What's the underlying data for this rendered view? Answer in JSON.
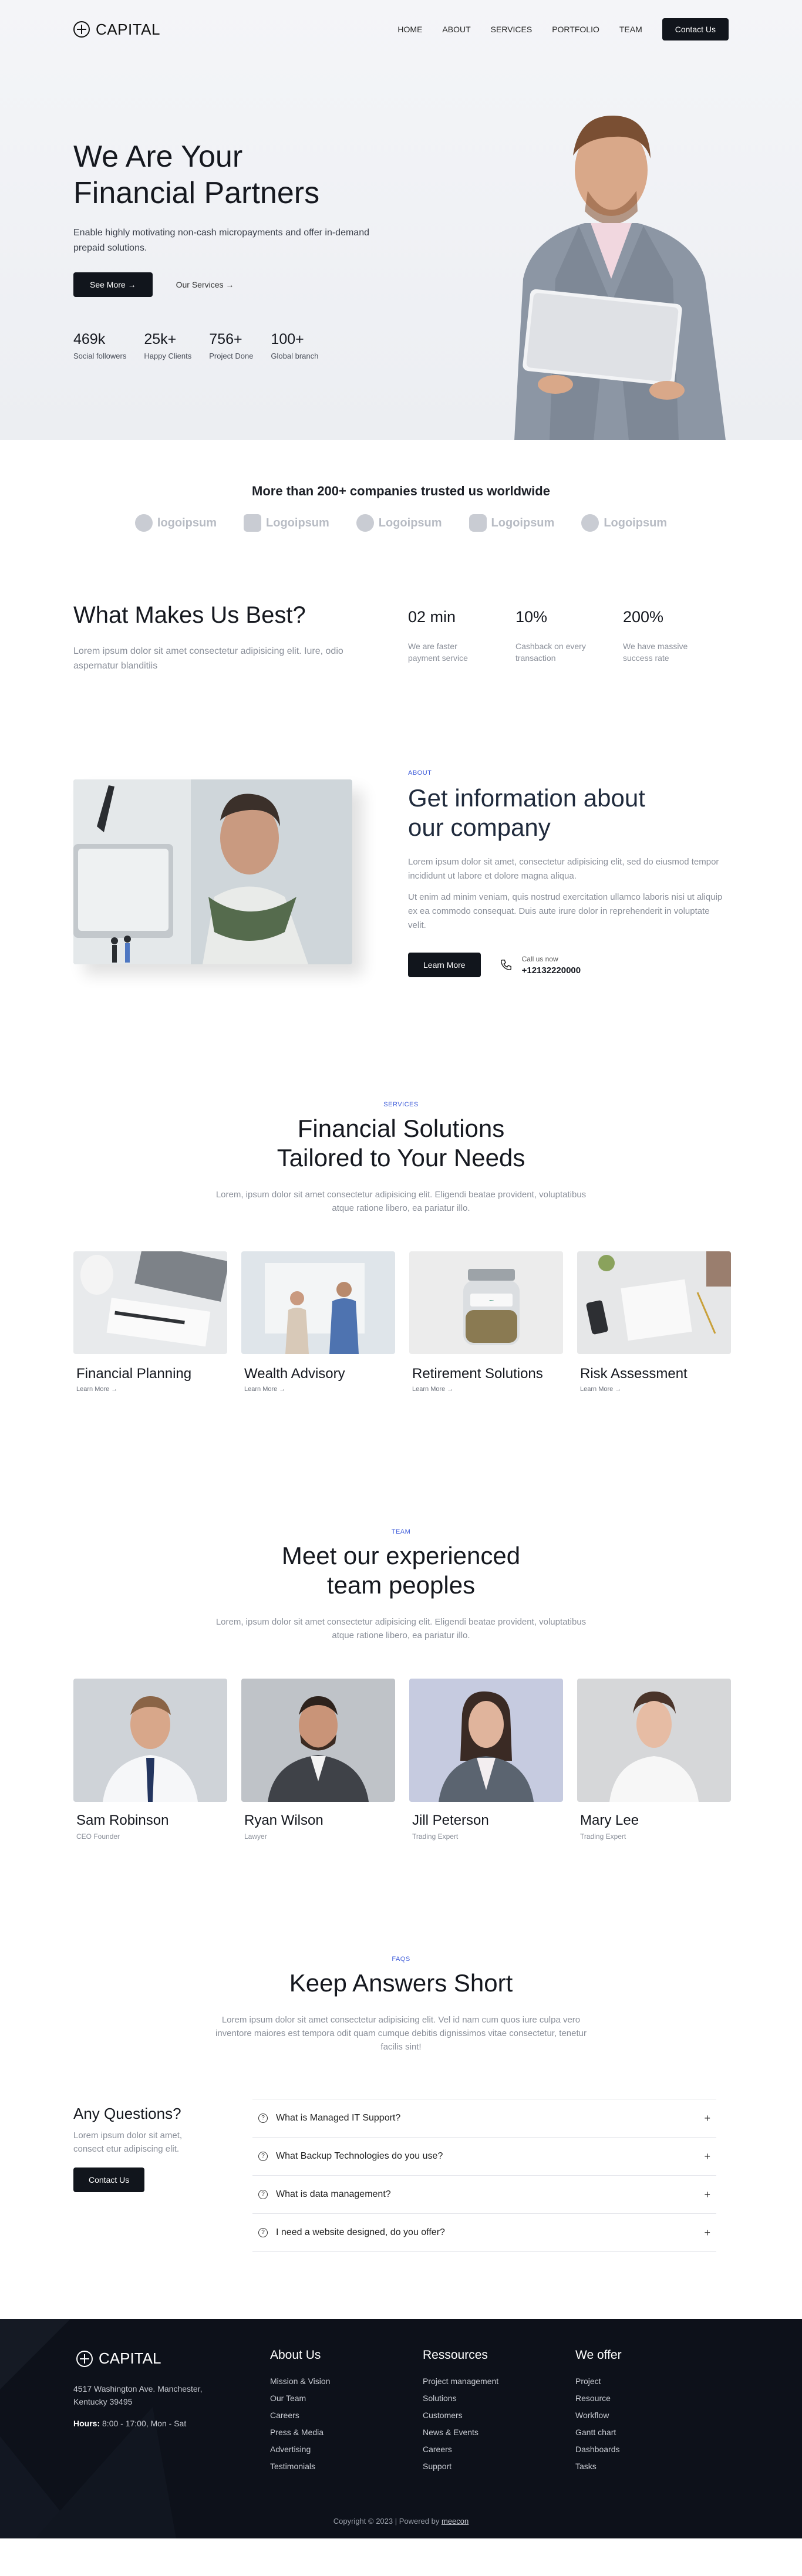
{
  "brand": "CAPITAL",
  "nav": {
    "links": [
      "HOME",
      "ABOUT",
      "SERVICES",
      "PORTFOLIO",
      "TEAM"
    ],
    "cta": "Contact Us"
  },
  "hero": {
    "title_line1": "We Are Your",
    "title_line2": "Financial Partners",
    "subtitle": "Enable highly motivating non-cash micropayments and offer in-demand prepaid solutions.",
    "primary_button": "See More →",
    "secondary_link": "Our Services →",
    "stats": [
      {
        "value": "469k",
        "label": "Social followers"
      },
      {
        "value": "25k+",
        "label": "Happy Clients"
      },
      {
        "value": "756+",
        "label": "Project Done"
      },
      {
        "value": "100+",
        "label": "Global branch"
      }
    ]
  },
  "trusted": {
    "title": "More than 200+ companies trusted us worldwide",
    "logos": [
      "logoipsum",
      "Logoipsum",
      "Logoipsum",
      "Logoipsum",
      "Logoipsum"
    ]
  },
  "why": {
    "title": "What Makes Us Best?",
    "text": "Lorem ipsum dolor sit amet consectetur adipisicing elit. Iure, odio aspernatur blanditiis",
    "stats": [
      {
        "value": "02 min",
        "label": "We are faster payment service"
      },
      {
        "value": "10%",
        "label": "Cashback on every transaction"
      },
      {
        "value": "200%",
        "label": "We have massive success rate"
      }
    ]
  },
  "about": {
    "eyebrow": "ABOUT",
    "title_line1": "Get information about",
    "title_line2": "our company",
    "para1": "Lorem ipsum dolor sit amet, consectetur adipisicing elit, sed do eiusmod tempor incididunt ut labore et dolore magna aliqua.",
    "para2": "Ut enim ad minim veniam, quis nostrud exercitation ullamco laboris nisi ut aliquip ex ea commodo consequat. Duis aute irure dolor in reprehenderit in voluptate velit.",
    "button": "Learn More",
    "call_label": "Call us now",
    "call_number": "+12132220000"
  },
  "services": {
    "eyebrow": "SERVICES",
    "title_line1": "Financial Solutions",
    "title_line2": "Tailored to Your Needs",
    "text": "Lorem, ipsum dolor sit amet consectetur adipisicing elit. Eligendi beatae provident, voluptatibus atque ratione libero, ea pariatur illo.",
    "cards": [
      {
        "title": "Financial Planning",
        "link": "Learn More →"
      },
      {
        "title": "Wealth Advisory",
        "link": "Learn More →"
      },
      {
        "title": "Retirement Solutions",
        "link": "Learn More →"
      },
      {
        "title": "Risk Assessment",
        "link": "Learn More →"
      }
    ]
  },
  "team": {
    "eyebrow": "TEAM",
    "title_line1": "Meet our experienced",
    "title_line2": "team peoples",
    "text": "Lorem, ipsum dolor sit amet consectetur adipisicing elit. Eligendi beatae provident, voluptatibus atque ratione libero, ea pariatur illo.",
    "members": [
      {
        "name": "Sam Robinson",
        "role": "CEO Founder"
      },
      {
        "name": "Ryan Wilson",
        "role": "Lawyer"
      },
      {
        "name": "Jill Peterson",
        "role": "Trading Expert"
      },
      {
        "name": "Mary Lee",
        "role": "Trading Expert"
      }
    ]
  },
  "faq": {
    "eyebrow": "FAQS",
    "title": "Keep Answers Short",
    "text": "Lorem ipsum dolor sit amet consectetur adipisicing elit. Vel id nam cum quos iure culpa vero inventore maiores est tempora odit quam cumque debitis dignissimos vitae consectetur, tenetur facilis sint!",
    "side_title": "Any Questions?",
    "side_text": "Lorem ipsum dolor sit amet, consect etur adipiscing elit.",
    "side_button": "Contact Us",
    "questions": [
      "What is Managed IT Support?",
      "What Backup Technologies do you use?",
      "What is data management?",
      "I need a website designed, do you offer?"
    ]
  },
  "footer": {
    "brand": "CAPITAL",
    "address": "4517 Washington Ave. Manchester, Kentucky 39495",
    "hours_label": "Hours:",
    "hours_value": " 8:00 - 17:00, Mon - Sat",
    "columns": [
      {
        "title": "About Us",
        "items": [
          "Mission & Vision",
          "Our Team",
          "Careers",
          "Press & Media",
          "Advertising",
          "Testimonials"
        ]
      },
      {
        "title": "Ressources",
        "items": [
          "Project management",
          "Solutions",
          "Customers",
          "News & Events",
          "Careers",
          "Support"
        ]
      },
      {
        "title": "We offer",
        "items": [
          "Project",
          "Resource",
          "Workflow",
          "Gantt chart",
          "Dashboards",
          "Tasks"
        ]
      }
    ],
    "copyright": "Copyright © 2023 | Powered by ",
    "copyright_link": "meecon"
  }
}
